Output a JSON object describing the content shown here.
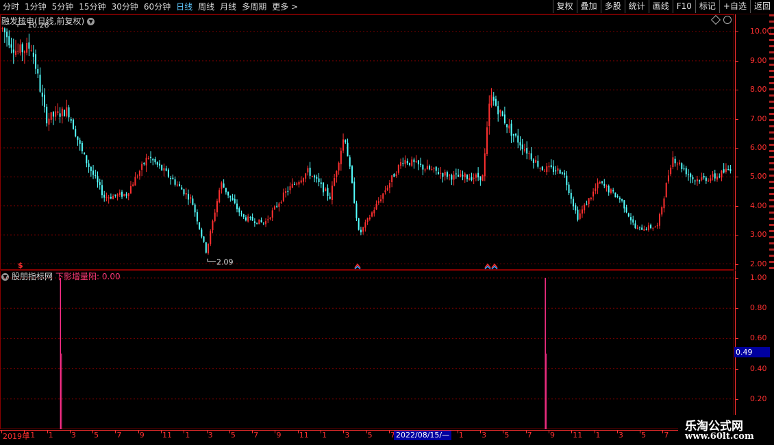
{
  "toolbar": {
    "tabs": [
      "分时",
      "1分钟",
      "5分钟",
      "15分钟",
      "30分钟",
      "60分钟",
      "日线",
      "周线",
      "月线",
      "多周期",
      "更多 >"
    ],
    "active_tab": "日线",
    "right_buttons": [
      "复权",
      "叠加",
      "多股",
      "统计",
      "画线",
      "F10",
      "标记",
      "+自选",
      "返回"
    ]
  },
  "main_panel": {
    "title": "融发核电(日线,前复权)",
    "high_label": "10.26",
    "low_label": "2.09",
    "price_ticks": [
      "10.00",
      "9.00",
      "8.00",
      "7.00",
      "6.00",
      "5.00",
      "4.00",
      "3.00",
      "2.00"
    ],
    "marker_s": "$"
  },
  "indicator_panel": {
    "name": "股朋指标网",
    "value_text": "下影增量阳: 0.00",
    "ticks": [
      "1.00",
      "0.80",
      "0.60",
      "0.40",
      "0.20"
    ],
    "current_value": "0.49"
  },
  "date_axis": {
    "labels": [
      "2019年",
      "11",
      "1",
      "3",
      "5",
      "7",
      "9",
      "11",
      "1",
      "3",
      "5",
      "7",
      "9",
      "11",
      "1",
      "3",
      "5",
      "7",
      "9",
      "11",
      "1",
      "3",
      "5",
      "7",
      "9",
      "11",
      "1",
      "3",
      "5",
      "7",
      "9",
      "1"
    ],
    "cursor_date": "2022/08/15/—"
  },
  "watermark": {
    "line1": "乐淘公式网",
    "line2": "www.60lt.com"
  },
  "colors": {
    "up": "#ff3030",
    "down": "#54ffff",
    "grid": "#7a0000",
    "signal": "#ff2f8a"
  },
  "chart_data": {
    "type": "candlestick",
    "title": "融发核电(日线,前复权)",
    "y_range": [
      1.8,
      10.6
    ],
    "key_points": [
      {
        "date": "2019年初",
        "price": 10.26,
        "note": "high"
      },
      {
        "date": "2020-04",
        "price": 2.09,
        "note": "low"
      }
    ],
    "approx_close_trend": [
      [
        0,
        10.1
      ],
      [
        0.02,
        9.3
      ],
      [
        0.04,
        9.5
      ],
      [
        0.06,
        7.0
      ],
      [
        0.09,
        7.3
      ],
      [
        0.11,
        5.8
      ],
      [
        0.14,
        4.3
      ],
      [
        0.17,
        4.4
      ],
      [
        0.2,
        5.7
      ],
      [
        0.23,
        5.0
      ],
      [
        0.26,
        4.2
      ],
      [
        0.28,
        2.4
      ],
      [
        0.3,
        4.8
      ],
      [
        0.33,
        3.6
      ],
      [
        0.36,
        3.4
      ],
      [
        0.39,
        4.5
      ],
      [
        0.42,
        5.2
      ],
      [
        0.45,
        4.3
      ],
      [
        0.47,
        6.5
      ],
      [
        0.49,
        3.0
      ],
      [
        0.52,
        4.3
      ],
      [
        0.55,
        5.6
      ],
      [
        0.58,
        5.3
      ],
      [
        0.62,
        5.0
      ],
      [
        0.66,
        5.0
      ],
      [
        0.67,
        7.8
      ],
      [
        0.7,
        6.5
      ],
      [
        0.74,
        5.3
      ],
      [
        0.77,
        5.2
      ],
      [
        0.79,
        3.6
      ],
      [
        0.82,
        4.8
      ],
      [
        0.85,
        4.2
      ],
      [
        0.87,
        3.2
      ],
      [
        0.9,
        3.3
      ],
      [
        0.92,
        5.7
      ],
      [
        0.95,
        4.9
      ],
      [
        0.98,
        5.0
      ],
      [
        1.0,
        5.3
      ]
    ],
    "signal_series": {
      "name": "下影增量阳",
      "spikes": [
        {
          "pos": 0.081,
          "value": 1.0
        },
        {
          "pos": 0.745,
          "value": 1.0
        }
      ],
      "y_range": [
        0,
        1.05
      ]
    }
  }
}
